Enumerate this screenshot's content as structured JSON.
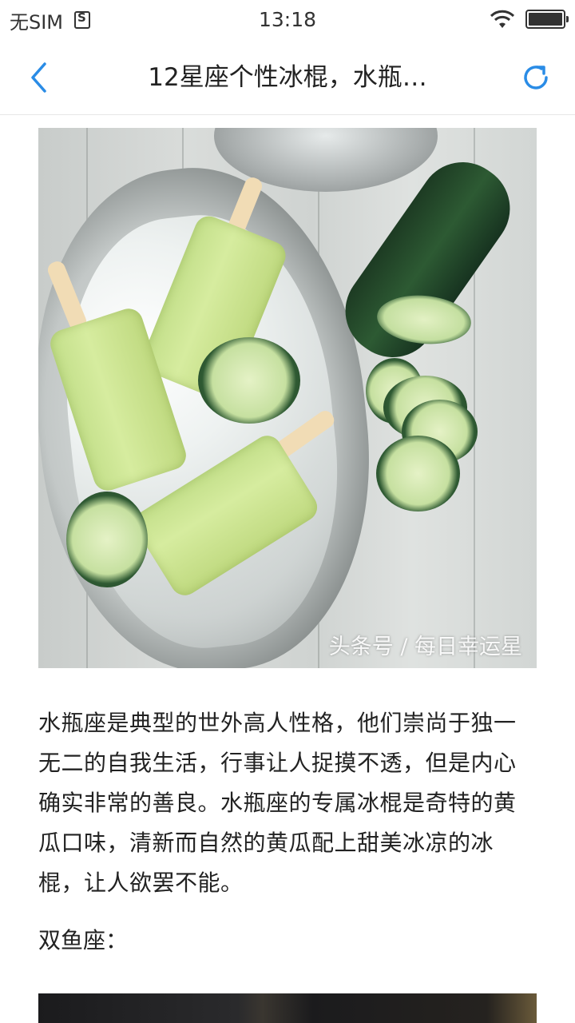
{
  "status_bar": {
    "carrier": "无SIM",
    "time": "13:18",
    "battery_level": 1.0
  },
  "nav": {
    "title": "12星座个性冰棍，水瓶…",
    "back_icon": "chevron-left-icon",
    "refresh_icon": "refresh-icon",
    "accent_color": "#2a8ce6"
  },
  "article": {
    "image_watermark": "头条号 / 每日幸运星",
    "paragraph": "水瓶座是典型的世外高人性格，他们崇尚于独一无二的自我生活，行事让人捉摸不透，但是内心确实非常的善良。水瓶座的专属冰棍是奇特的黄瓜口味，清新而自然的黄瓜配上甜美冰凉的冰棍，让人欲罢不能。",
    "subheading": "双鱼座："
  }
}
